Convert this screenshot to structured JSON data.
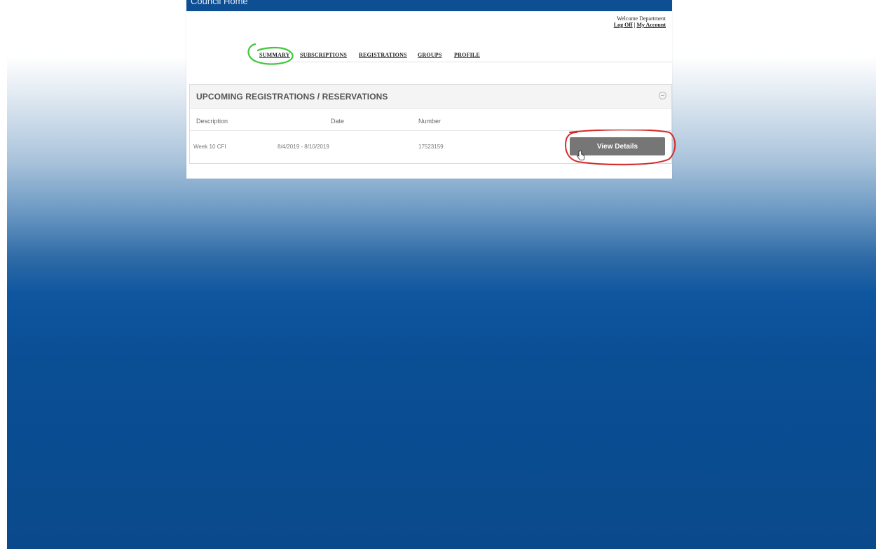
{
  "header": {
    "title": "Council Home",
    "welcome_text": "Welcome Department",
    "log_off": "Log Off",
    "separator": "|",
    "my_account": "My Account"
  },
  "nav": {
    "tabs": [
      {
        "label": "SUMMARY"
      },
      {
        "label": "SUBSCRIPTIONS"
      },
      {
        "label": "REGISTRATIONS"
      },
      {
        "label": "GROUPS"
      },
      {
        "label": "PROFILE"
      }
    ]
  },
  "panel": {
    "title": "UPCOMING REGISTRATIONS / RESERVATIONS",
    "columns": [
      "Description",
      "Date",
      "Number"
    ],
    "rows": [
      {
        "description": "Week 10 CFI",
        "date": "8/4/2019 - 8/10/2019",
        "number": "17523159",
        "action": "View Details"
      }
    ]
  },
  "annotations": {
    "green_circle_color": "#3fc83a",
    "red_circle_color": "#d42a2a"
  },
  "colors": {
    "top_bar": "#0e4f94",
    "button": "#767676",
    "background_blue": "#0a4e94"
  }
}
